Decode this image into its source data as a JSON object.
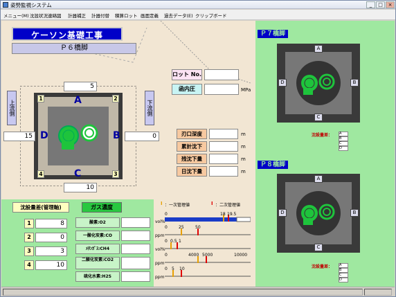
{
  "window": {
    "title": "姿勢監視システム"
  },
  "menu": [
    "メニュー(M)",
    "沈設状況連絡図",
    "計器補正",
    "計器付替",
    "積算ロット",
    "画面定義",
    "過去データ(E)",
    "クリップボード"
  ],
  "header": {
    "company": "ケーソン基礎工事",
    "pier": "Ｐ６橋脚"
  },
  "flow": {
    "upstream": "上流側",
    "downstream": "下流側"
  },
  "caisson": {
    "letters": {
      "A": "A",
      "B": "B",
      "C": "C",
      "D": "D"
    },
    "corners": [
      "1",
      "2",
      "3",
      "4"
    ],
    "top_value": "5",
    "left_value": "15",
    "right_value": "0",
    "bottom_value": "10"
  },
  "lot": {
    "label": "ロット No.",
    "value": ""
  },
  "pressure": {
    "label": "函内圧",
    "value": "",
    "unit": "MPa"
  },
  "measures": [
    {
      "label": "刃口深度",
      "unit": "m"
    },
    {
      "label": "累計沈下",
      "unit": "m"
    },
    {
      "label": "残沈下量",
      "unit": "m"
    },
    {
      "label": "日沈下量",
      "unit": "m"
    }
  ],
  "settle": {
    "title": "沈設量差(管理軸)",
    "rows": [
      {
        "n": "1",
        "v": "8"
      },
      {
        "n": "2",
        "v": "0"
      },
      {
        "n": "3",
        "v": "3"
      },
      {
        "n": "4",
        "v": "10"
      }
    ]
  },
  "gas": {
    "title": "ガス濃度",
    "items": [
      "酸素:O2",
      "一酸化炭素:CO",
      "ﾒﾀﾝｶﾞｽ:CH4",
      "二酸化炭素:CO2",
      "硫化水素:H2S"
    ]
  },
  "legend": {
    "primary": "：一次管理値",
    "secondary": "：二次管理値"
  },
  "gauges": [
    {
      "unit": "vol%",
      "ticks": [
        "0",
        "18",
        "19.5"
      ]
    },
    {
      "unit": "ppm",
      "ticks": [
        "0",
        "25",
        "50"
      ]
    },
    {
      "unit": "vol%",
      "ticks": [
        "0",
        "0.5",
        "1"
      ]
    },
    {
      "unit": "ppm",
      "ticks": [
        "0",
        "4000",
        "5000",
        "10000"
      ]
    },
    {
      "unit": "ppm",
      "ticks": [
        "0",
        "5",
        "10"
      ]
    }
  ],
  "right_piers": [
    {
      "title": "Ｐ７橋脚",
      "letters": [
        "A",
        "B",
        "C",
        "D"
      ],
      "label": "沈設量差："
    },
    {
      "title": "Ｐ８橋脚",
      "letters": [
        "A",
        "B",
        "C",
        "D"
      ],
      "label": "沈設量差："
    }
  ],
  "colors": {
    "green": "#9fe8a0",
    "navy": "#0000c8",
    "site": "#f2e6d3"
  }
}
